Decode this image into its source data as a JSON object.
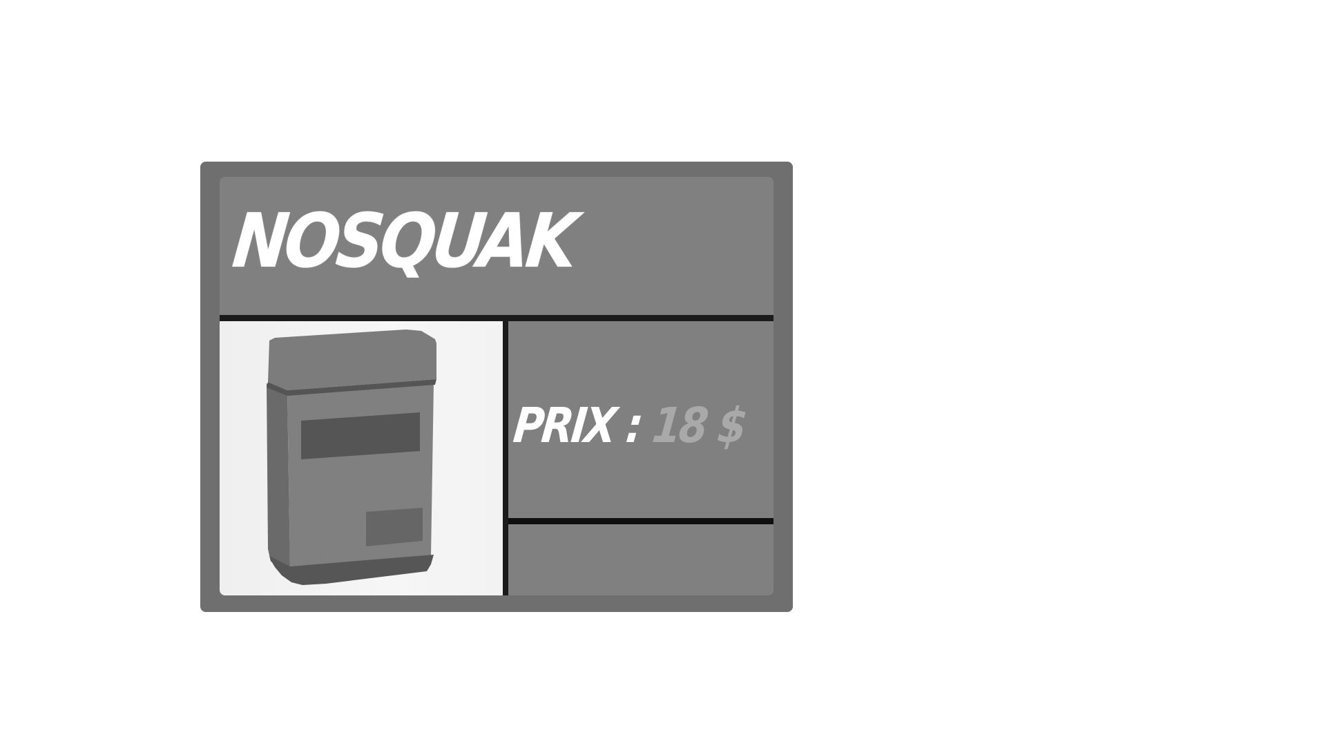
{
  "shop_card": {
    "title": "NOSQUAK",
    "price_label": "PRIX : ",
    "price_value": "18 $",
    "product_icon": "grey-box-canister-icon"
  },
  "colors": {
    "card_border": "#6f6f6f",
    "card_fill": "#808080",
    "divider": "#1b1b1b",
    "title_text": "#ffffff",
    "price_value_text": "#a9a9a9",
    "product_background": "#f4f4f4"
  }
}
